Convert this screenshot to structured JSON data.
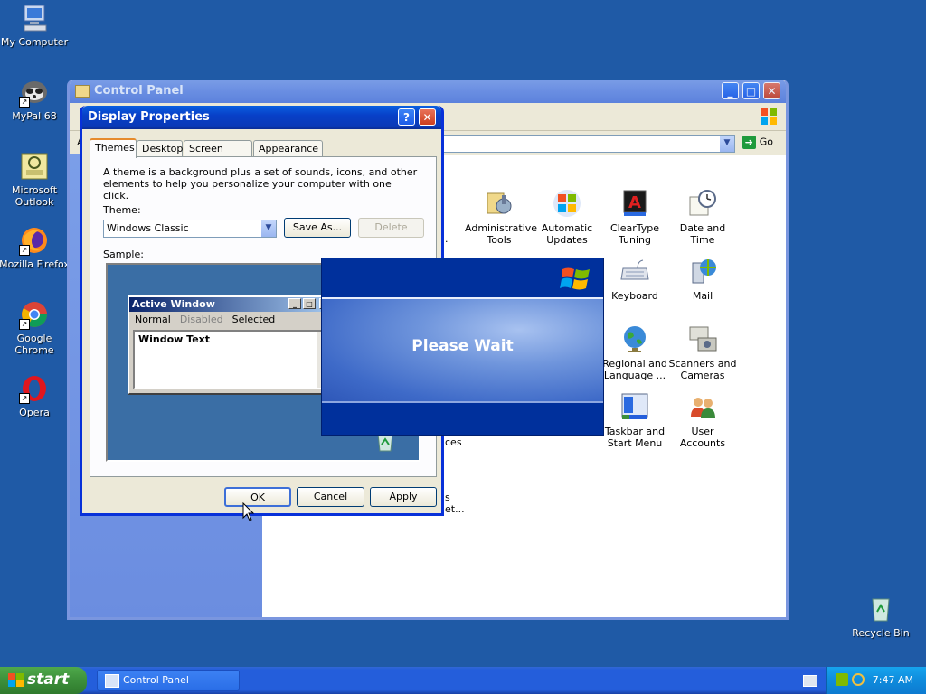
{
  "desktop": {
    "icons": [
      {
        "label": "My Computer"
      },
      {
        "label": "MyPal 68"
      },
      {
        "label": "Microsoft Outlook"
      },
      {
        "label": "Mozilla Firefox"
      },
      {
        "label": "Google Chrome"
      },
      {
        "label": "Opera"
      },
      {
        "label": "Recycle Bin"
      }
    ]
  },
  "control_panel": {
    "title": "Control Panel",
    "address_prefix": "A",
    "go_label": "Go",
    "items": [
      {
        "label": "Administrative Tools"
      },
      {
        "label": "Automatic Updates"
      },
      {
        "label": "ClearType Tuning"
      },
      {
        "label": "Date and Time"
      },
      {
        "label": "Keyboard"
      },
      {
        "label": "Mail"
      },
      {
        "label": "Regional and Language ..."
      },
      {
        "label": "Scanners and Cameras"
      },
      {
        "label": "Taskbar and Start Menu"
      },
      {
        "label": "User Accounts"
      }
    ],
    "partial_text": {
      "a": ".",
      "b": "ces",
      "c": "s",
      "d": "et..."
    }
  },
  "display_properties": {
    "title": "Display Properties",
    "help_btn": "?",
    "tabs": [
      {
        "label": "Themes"
      },
      {
        "label": "Desktop"
      },
      {
        "label": "Screen Saver"
      },
      {
        "label": "Appearance"
      }
    ],
    "description": "A theme is a background plus a set of sounds, icons, and other elements to help you personalize your computer with one click.",
    "theme_label": "Theme:",
    "theme_value": "Windows Classic",
    "save_as_label": "Save As...",
    "delete_label": "Delete",
    "sample_label": "Sample:",
    "sample_window": {
      "title": "Active Window",
      "menu": [
        "Normal",
        "Disabled",
        "Selected"
      ],
      "text": "Window Text"
    },
    "ok_label": "OK",
    "cancel_label": "Cancel",
    "apply_label": "Apply"
  },
  "please_wait": {
    "message": "Please Wait"
  },
  "taskbar": {
    "start_label": "start",
    "task_label": "Control Panel",
    "clock": "7:47 AM"
  }
}
